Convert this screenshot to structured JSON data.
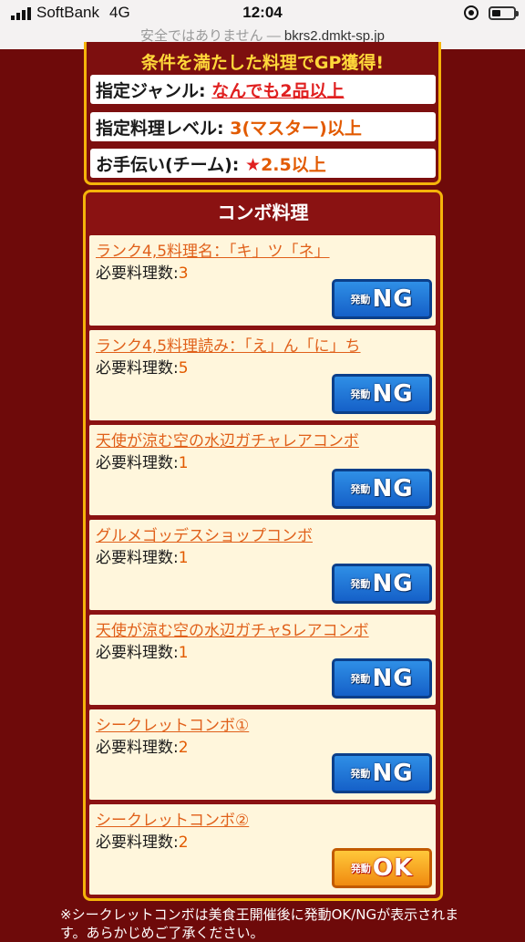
{
  "status_bar": {
    "carrier": "SoftBank",
    "network": "4G",
    "time": "12:04"
  },
  "url_bar": {
    "security_text": "安全ではありません",
    "separator": "—",
    "host": "bkrs2.dmkt-sp.jp"
  },
  "conditions": {
    "title": "条件を満たした料理でGP獲得!",
    "genre": {
      "label": "指定ジャンル:",
      "value": "なんでも2品以上"
    },
    "level": {
      "label": "指定料理レベル:",
      "value": "3(マスター)以上"
    },
    "helper": {
      "label": "お手伝い(チーム):",
      "star": "★",
      "value": "2.5以上"
    }
  },
  "combo": {
    "header": "コンボ料理",
    "req_label": "必要料理数:",
    "items": [
      {
        "name": "ランク4,5料理名：「キ」ツ「ネ」",
        "count": "3",
        "btn_pre": "発動",
        "btn_main": "NG"
      },
      {
        "name": "ランク4,5料理読み：「え」ん「に」ち",
        "count": "5",
        "btn_pre": "発動",
        "btn_main": "NG"
      },
      {
        "name": "天使が涼む空の水辺ガチャレアコンボ",
        "count": "1",
        "btn_pre": "発動",
        "btn_main": "NG"
      },
      {
        "name": "グルメゴッデスショップコンボ",
        "count": "1",
        "btn_pre": "発動",
        "btn_main": "NG"
      },
      {
        "name": "天使が涼む空の水辺ガチャSレアコンボ",
        "count": "1",
        "btn_pre": "発動",
        "btn_main": "NG"
      },
      {
        "name": "シークレットコンボ①",
        "count": "2",
        "btn_pre": "発動",
        "btn_main": "NG"
      },
      {
        "name": "シークレットコンボ②",
        "count": "2",
        "btn_pre": "発動",
        "btn_main": "OK"
      }
    ]
  },
  "footnote": "※シークレットコンボは美食王開催後に発動OK/NGが表示されます。あらかじめご了承ください。",
  "colors": {
    "background": "#6e0a0a",
    "panel_border": "#f5b40a",
    "link_orange": "#e0601a",
    "ng_blue": "#1560c8",
    "ok_orange": "#f08a10"
  }
}
